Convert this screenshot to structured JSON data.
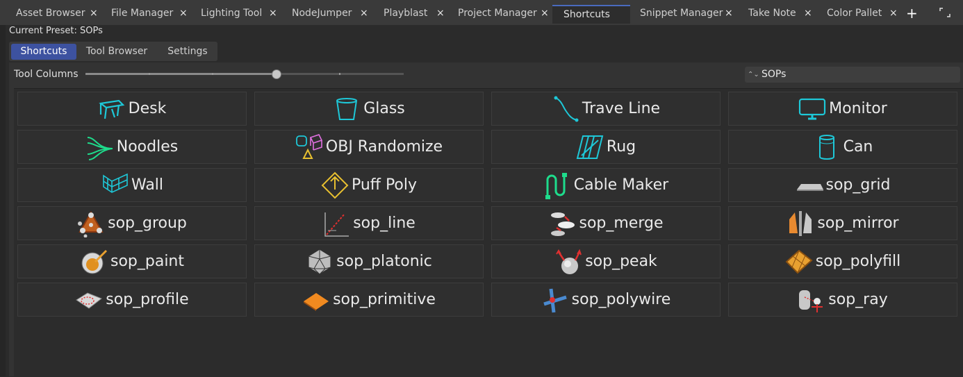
{
  "tabs": [
    {
      "label": "Asset Browser"
    },
    {
      "label": "File Manager"
    },
    {
      "label": "Lighting Tool"
    },
    {
      "label": "NodeJumper"
    },
    {
      "label": "Playblast"
    },
    {
      "label": "Project Manager"
    },
    {
      "label": "Shortcuts",
      "active": true
    },
    {
      "label": "Snippet Manager"
    },
    {
      "label": "Take Note"
    },
    {
      "label": "Color Pallet"
    }
  ],
  "tab_close_glyph": "×",
  "add_tab_glyph": "+",
  "preset_label": "Current Preset: SOPs",
  "subtabs": [
    {
      "label": "Shortcuts",
      "active": true
    },
    {
      "label": "Tool Browser"
    },
    {
      "label": "Settings"
    }
  ],
  "tool_columns_label": "Tool  Columns",
  "tool_columns": {
    "value": 4,
    "min": 1,
    "max": 6
  },
  "preset_select": {
    "value": "SOPs",
    "arrows": "⌃⌄"
  },
  "tools": [
    {
      "label": "Desk",
      "icon": "desk-icon"
    },
    {
      "label": "Glass",
      "icon": "glass-icon"
    },
    {
      "label": "Trave Line",
      "icon": "curve-icon"
    },
    {
      "label": "Monitor",
      "icon": "monitor-icon"
    },
    {
      "label": "Noodles",
      "icon": "noodles-icon"
    },
    {
      "label": "OBJ Randomize",
      "icon": "randomize-icon"
    },
    {
      "label": "Rug",
      "icon": "rug-icon"
    },
    {
      "label": "Can",
      "icon": "can-icon"
    },
    {
      "label": "Wall",
      "icon": "wall-icon"
    },
    {
      "label": "Puff Poly",
      "icon": "puff-icon"
    },
    {
      "label": "Cable Maker",
      "icon": "cable-icon"
    },
    {
      "label": "sop_grid",
      "icon": "grid-icon"
    },
    {
      "label": "sop_group",
      "icon": "group-icon"
    },
    {
      "label": "sop_line",
      "icon": "line-icon"
    },
    {
      "label": "sop_merge",
      "icon": "merge-icon"
    },
    {
      "label": "sop_mirror",
      "icon": "mirror-icon"
    },
    {
      "label": "sop_paint",
      "icon": "paint-icon"
    },
    {
      "label": "sop_platonic",
      "icon": "platonic-icon"
    },
    {
      "label": "sop_peak",
      "icon": "peak-icon"
    },
    {
      "label": "sop_polyfill",
      "icon": "polyfill-icon"
    },
    {
      "label": "sop_profile",
      "icon": "profile-icon"
    },
    {
      "label": "sop_primitive",
      "icon": "primitive-icon"
    },
    {
      "label": "sop_polywire",
      "icon": "polywire-icon"
    },
    {
      "label": "sop_ray",
      "icon": "ray-icon"
    }
  ],
  "colors": {
    "accent": "#3d52a0",
    "tab_highlight": "#4a6bbf",
    "cyan_icon": "#1ec8d8",
    "green_icon": "#1edc8c",
    "yellow_icon": "#e8c030"
  }
}
